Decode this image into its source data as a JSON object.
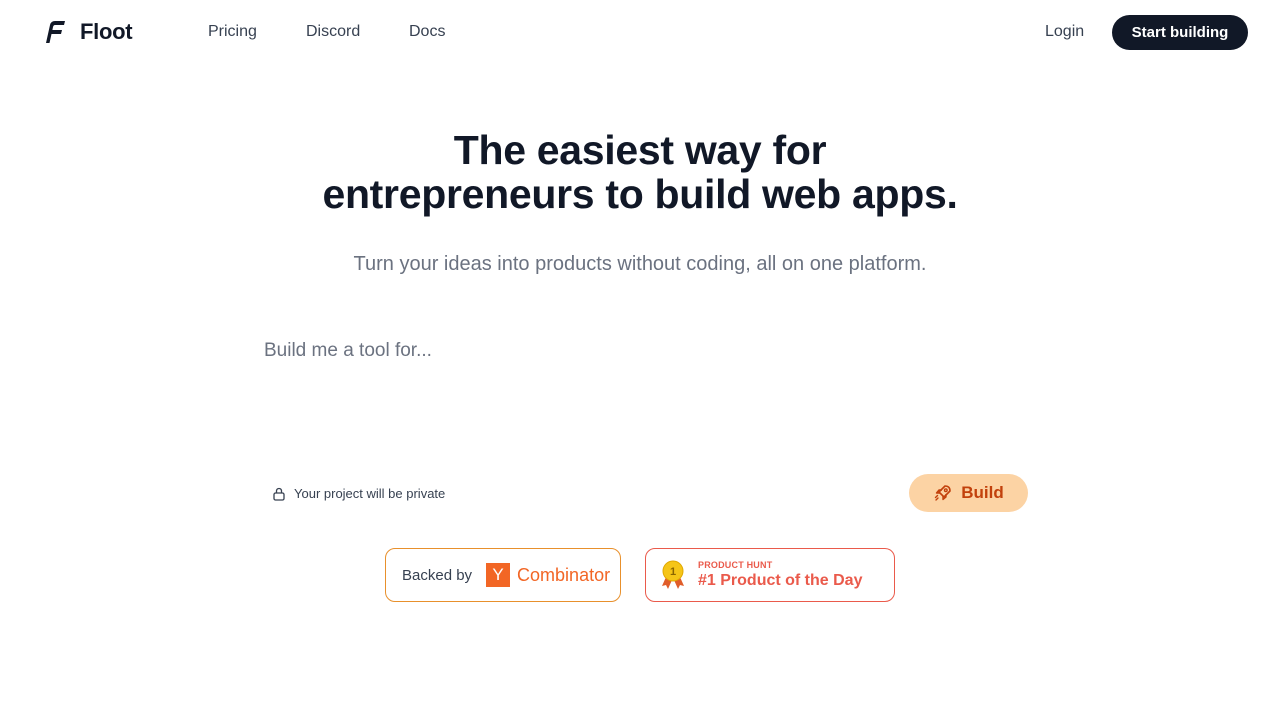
{
  "header": {
    "brand": "Floot",
    "nav": [
      {
        "label": "Pricing"
      },
      {
        "label": "Discord"
      },
      {
        "label": "Docs"
      }
    ],
    "login_label": "Login",
    "cta_label": "Start building"
  },
  "hero": {
    "title_line1": "The easiest way for",
    "title_line2": "entrepreneurs to build web apps.",
    "subtitle": "Turn your ideas into products without coding, all on one platform."
  },
  "prompt": {
    "placeholder": "Build me a tool for...",
    "value": ""
  },
  "privacy_note": "Your project will be private",
  "build_label": "Build",
  "badges": {
    "yc": {
      "prefix": "Backed by",
      "logo_letter": "Y",
      "name": "Combinator"
    },
    "product_hunt": {
      "small": "PRODUCT HUNT",
      "big": "#1 Product of the Day",
      "medal_number": "1"
    }
  },
  "colors": {
    "primary_dark": "#111827",
    "build_bg": "#fcd3a4",
    "build_text": "#c2410c",
    "yc_orange": "#f26625",
    "ph_red": "#ea5a4b"
  },
  "icons": [
    "floot-logo-icon",
    "lock-icon",
    "rocket-icon",
    "medal-icon"
  ]
}
